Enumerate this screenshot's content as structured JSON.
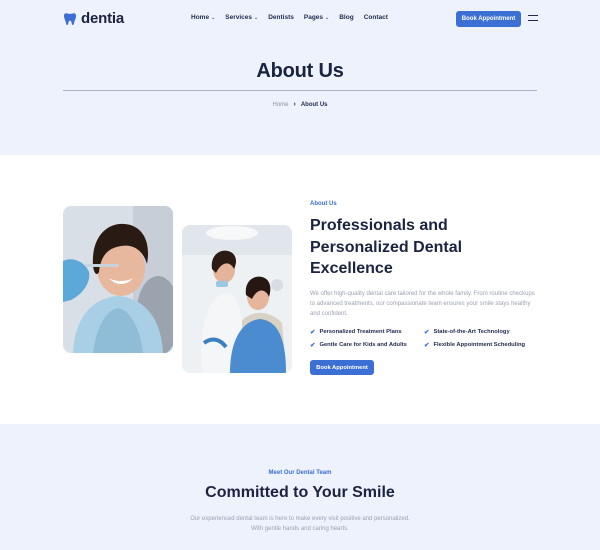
{
  "brand": {
    "name": "dentia",
    "accent_color": "#3b6fd4",
    "icon": "tooth-icon"
  },
  "nav": {
    "items": [
      {
        "label": "Home",
        "has_dropdown": true
      },
      {
        "label": "Services",
        "has_dropdown": true
      },
      {
        "label": "Dentists",
        "has_dropdown": false
      },
      {
        "label": "Pages",
        "has_dropdown": true
      },
      {
        "label": "Blog",
        "has_dropdown": false
      },
      {
        "label": "Contact",
        "has_dropdown": false
      }
    ],
    "cta_label": "Book Appointment",
    "menu_icon": "hamburger-icon"
  },
  "hero": {
    "title": "About Us",
    "breadcrumb": {
      "home": "Home",
      "separator": "›",
      "current": "About Us"
    }
  },
  "about": {
    "eyebrow": "About Us",
    "heading": "Professionals and Personalized Dental Excellence",
    "description": "We offer high-quality dental care tailored for the whole family. From routine checkups to advanced treatments, our compassionate team ensures your smile stays healthy and confident.",
    "features": [
      "Personalized Treatment Plans",
      "State-of-the-Art Technology",
      "Gentle Care for Kids and Adults",
      "Flexible Appointment Scheduling"
    ],
    "cta_label": "Book Appointment"
  },
  "team": {
    "eyebrow": "Meet Our Dental Team",
    "heading": "Committed to Your Smile",
    "description_line1": "Our experienced dental team is here to make every visit positive and personalized.",
    "description_line2": "With gentle hands and caring hearts."
  }
}
